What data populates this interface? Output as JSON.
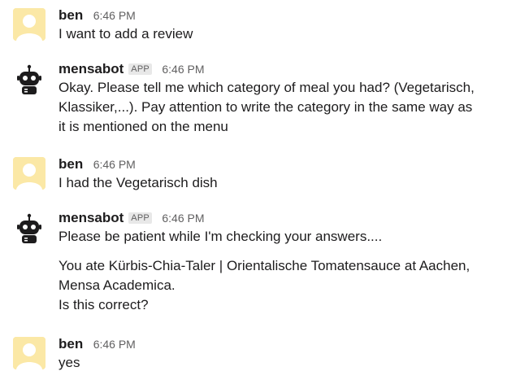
{
  "messages": [
    {
      "author": "ben",
      "time": "6:46 PM",
      "avatar": "user-avatar-placeholder",
      "lines": [
        "I want to add a review"
      ]
    },
    {
      "author": "mensabot",
      "badge": "APP",
      "time": "6:46 PM",
      "avatar": "robot-icon",
      "lines": [
        "Okay. Please tell me which category of meal you had? (Vegetarisch,",
        "Klassiker,...). Pay attention to write the category in the same way as",
        "it is mentioned on the menu"
      ]
    },
    {
      "author": "ben",
      "time": "6:46 PM",
      "avatar": "user-avatar-placeholder",
      "lines": [
        "I had the Vegetarisch dish"
      ]
    },
    {
      "author": "mensabot",
      "badge": "APP",
      "time": "6:46 PM",
      "avatar": "robot-icon",
      "lines": [
        "Please be patient while I'm checking your answers...."
      ],
      "lines2": [
        "You ate Kürbis-Chia-Taler | Orientalische Tomatensauce at Aachen,",
        "Mensa Academica.",
        "Is this correct?"
      ]
    },
    {
      "author": "ben",
      "time": "6:46 PM",
      "avatar": "user-avatar-placeholder",
      "lines": [
        "yes"
      ]
    }
  ],
  "colors": {
    "user_avatar_bg": "#fbe8a6",
    "user_avatar_fg": "#f6d24c",
    "bot_icon": "#1d1c1d",
    "text": "#1d1c1d",
    "muted": "#616061"
  }
}
